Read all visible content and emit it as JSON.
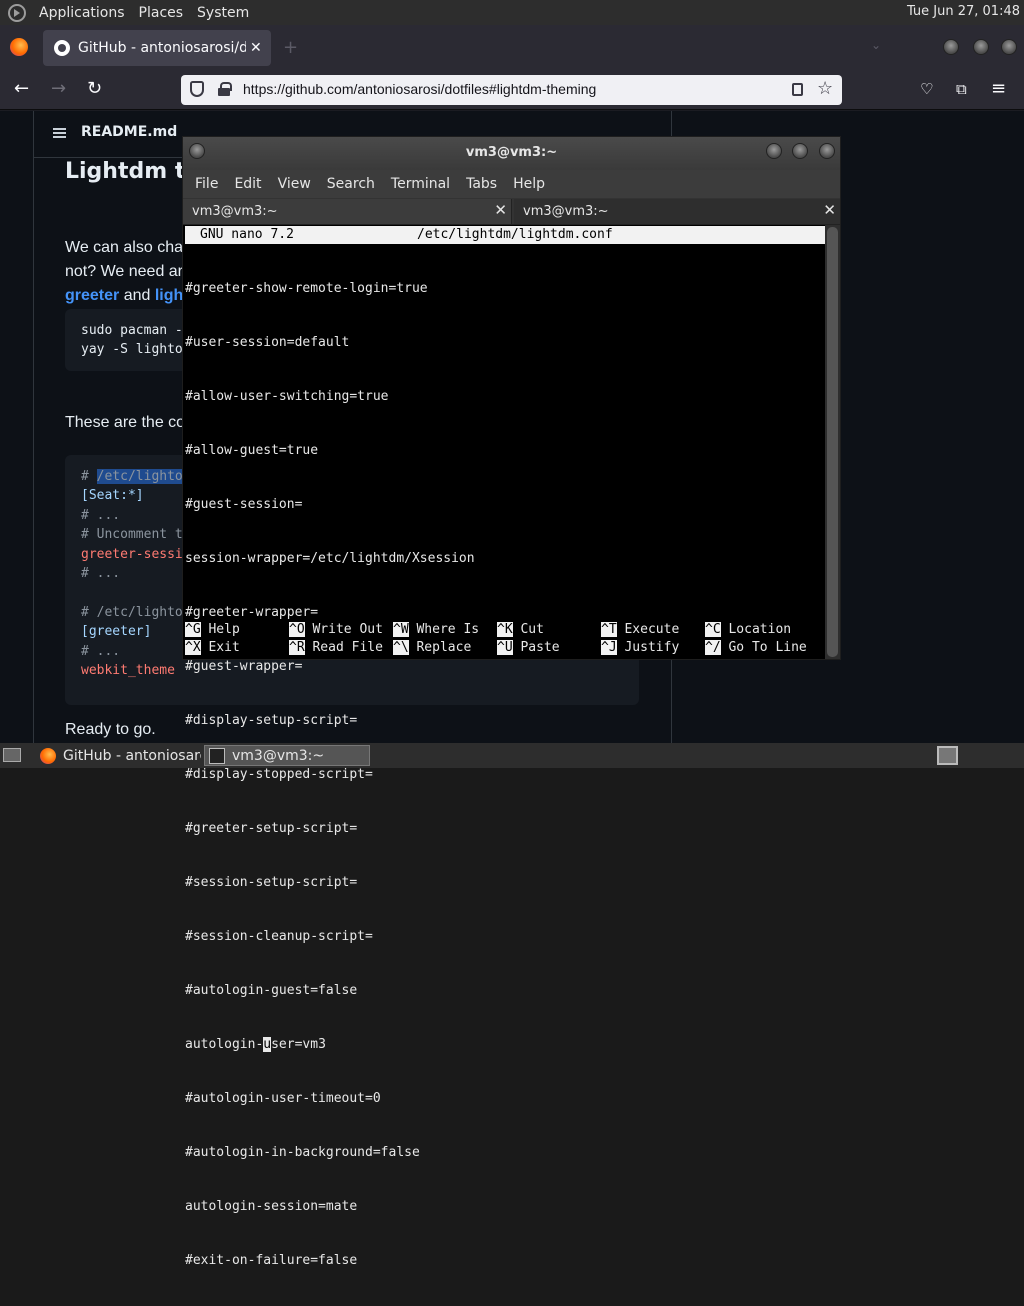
{
  "top_panel": {
    "menus": [
      "Applications",
      "Places",
      "System"
    ],
    "clock": "Tue Jun 27, 01:48"
  },
  "browser": {
    "tab_title": "GitHub - antoniosarosi/dotfiles",
    "url": "https://github.com/antoniosarosi/dotfiles#lightdm-theming"
  },
  "readme": {
    "filename": "README.md",
    "heading": "Lightdm th",
    "para1_line1": "We can also cha",
    "para1_line2": "not? We need ar",
    "para1_link1": "greeter",
    "para1_and": " and ",
    "para1_link2": "ligh",
    "code1": [
      "sudo pacman -",
      "yay -S lighto"
    ],
    "para2": "These are the co",
    "code2": {
      "l1_hash": "# ",
      "l1_sel": "/etc/lighto",
      "l2": "[Seat:*]",
      "l3": "# ...",
      "l4": "# Uncomment t",
      "l5": "greeter-sessi",
      "l6": "# ...",
      "l8": "# /etc/lighto",
      "l9": "[greeter]",
      "l10": "# ...",
      "l11": "webkit_theme"
    },
    "para3": "Ready to go."
  },
  "terminal": {
    "title": "vm3@vm3:~",
    "menu": [
      "File",
      "Edit",
      "View",
      "Search",
      "Terminal",
      "Tabs",
      "Help"
    ],
    "tabs": [
      "vm3@vm3:~",
      "vm3@vm3:~"
    ],
    "nano_version": "GNU nano 7.2",
    "nano_file": "/etc/lightdm/lightdm.conf",
    "lines": [
      "#greeter-show-remote-login=true",
      "#user-session=default",
      "#allow-user-switching=true",
      "#allow-guest=true",
      "#guest-session=",
      "session-wrapper=/etc/lightdm/Xsession",
      "#greeter-wrapper=",
      "#guest-wrapper=",
      "#display-setup-script=",
      "#display-stopped-script=",
      "#greeter-setup-script=",
      "#session-setup-script=",
      "#session-cleanup-script=",
      "#autologin-guest=false"
    ],
    "cursor_line": {
      "before": "autologin-",
      "cursor": "u",
      "after": "ser=vm3"
    },
    "lines_after": [
      "#autologin-user-timeout=0",
      "#autologin-in-background=false",
      "autologin-session=mate",
      "#exit-on-failure=false"
    ],
    "help_row1": [
      {
        "key": "^G",
        "label": "Help"
      },
      {
        "key": "^O",
        "label": "Write Out"
      },
      {
        "key": "^W",
        "label": "Where Is"
      },
      {
        "key": "^K",
        "label": "Cut"
      },
      {
        "key": "^T",
        "label": "Execute"
      },
      {
        "key": "^C",
        "label": "Location"
      }
    ],
    "help_row2": [
      {
        "key": "^X",
        "label": "Exit"
      },
      {
        "key": "^R",
        "label": "Read File"
      },
      {
        "key": "^\\",
        "label": "Replace"
      },
      {
        "key": "^U",
        "label": "Paste"
      },
      {
        "key": "^J",
        "label": "Justify"
      },
      {
        "key": "^/",
        "label": "Go To Line"
      }
    ]
  },
  "taskbar": {
    "items": [
      "GitHub - antoniosarosi/dotfiles",
      "vm3@vm3:~"
    ]
  }
}
